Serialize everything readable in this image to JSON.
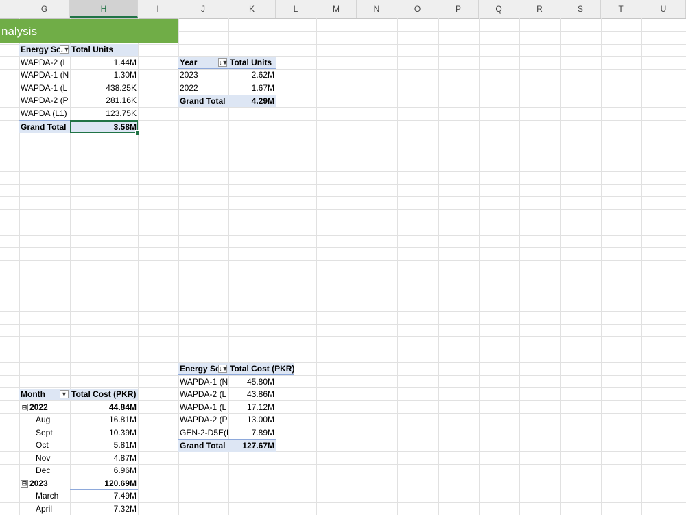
{
  "columns": [
    "G",
    "H",
    "I",
    "J",
    "K",
    "L",
    "M",
    "N",
    "O",
    "P",
    "Q",
    "R",
    "S",
    "T",
    "U"
  ],
  "selected_column": "H",
  "banner_text": "nalysis",
  "pivot_units_by_source": {
    "header": [
      "Energy So",
      "Total Units"
    ],
    "rows": [
      [
        "WAPDA-2 (L",
        "1.44M"
      ],
      [
        "WAPDA-1 (N",
        "1.30M"
      ],
      [
        "WAPDA-1 (L",
        "438.25K"
      ],
      [
        "WAPDA-2 (P",
        "281.16K"
      ],
      [
        "WAPDA (L1)",
        "123.75K"
      ]
    ],
    "total": [
      "Grand Total",
      "3.58M"
    ]
  },
  "pivot_units_by_year": {
    "header": [
      "Year",
      "Total Units"
    ],
    "rows": [
      [
        "2023",
        "2.62M"
      ],
      [
        "2022",
        "1.67M"
      ]
    ],
    "total": [
      "Grand Total",
      "4.29M"
    ]
  },
  "pivot_cost_by_source": {
    "header": [
      "Energy So",
      "Total Cost (PKR)"
    ],
    "rows": [
      [
        "WAPDA-1 (N",
        "45.80M"
      ],
      [
        "WAPDA-2 (L",
        "43.86M"
      ],
      [
        "WAPDA-1 (L",
        "17.12M"
      ],
      [
        "WAPDA-2 (P",
        "13.00M"
      ],
      [
        "GEN-2-D5E(L",
        "7.89M"
      ]
    ],
    "total": [
      "Grand Total",
      "127.67M"
    ]
  },
  "pivot_cost_by_month": {
    "header": [
      "Month",
      "Total Cost (PKR)"
    ],
    "groups": [
      {
        "label": "2022",
        "value": "44.84M",
        "items": [
          [
            "Aug",
            "16.81M"
          ],
          [
            "Sept",
            "10.39M"
          ],
          [
            "Oct",
            "5.81M"
          ],
          [
            "Nov",
            "4.87M"
          ],
          [
            "Dec",
            "6.96M"
          ]
        ]
      },
      {
        "label": "2023",
        "value": "120.69M",
        "items": [
          [
            "March",
            "7.49M"
          ],
          [
            "April",
            "7.32M"
          ]
        ]
      }
    ],
    "collapse_symbol": "⊟"
  },
  "icons": {
    "filter": "filter-icon",
    "sort": "sort-desc-icon",
    "dropdown": "dropdown-icon"
  }
}
